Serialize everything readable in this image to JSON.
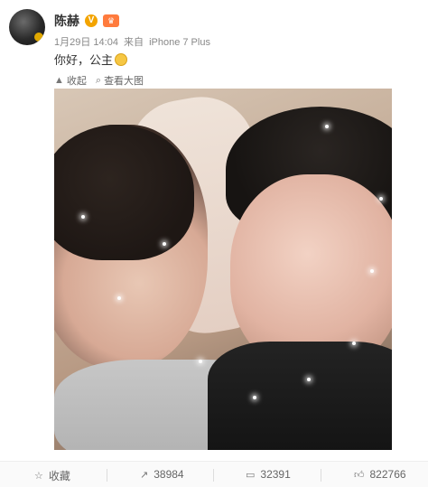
{
  "post": {
    "author": "陈赫",
    "date": "1月29日 14:04",
    "from_prefix": "来自",
    "device": "iPhone 7 Plus",
    "text": "你好，公主"
  },
  "actions_top": {
    "collapse": "收起",
    "view_large": "查看大图"
  },
  "footer": {
    "favorite": "收藏",
    "repost_count": "38984",
    "comment_count": "32391",
    "like_count": "822766"
  },
  "colors": {
    "verified_badge": "#f3a400",
    "vip_badge": "#ff7b3d"
  }
}
